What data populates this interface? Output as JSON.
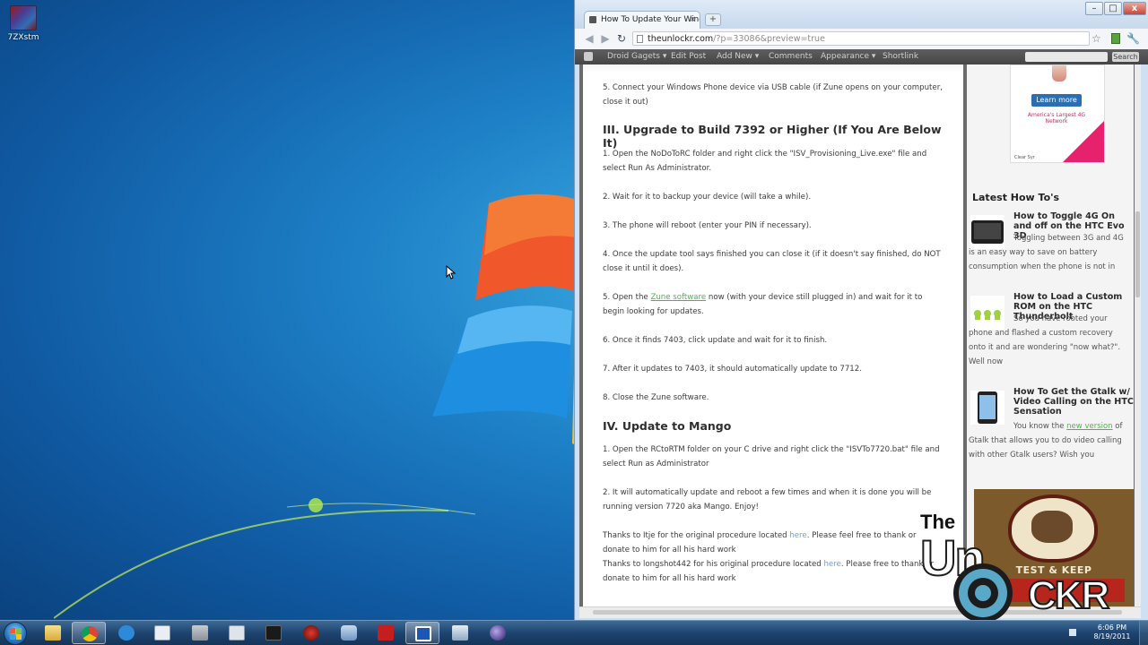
{
  "desktop": {
    "icons": [
      {
        "label": "7ZXstm"
      }
    ]
  },
  "browser": {
    "tab_title": "How To Update Your Windo",
    "tab_close": "×",
    "new_tab": "+",
    "url_host": "theunlockr.com",
    "url_path": "/?p=33086&preview=true",
    "window_buttons": {
      "minimize": "–",
      "maximize": "□",
      "close": "x"
    }
  },
  "wp_admin_bar": {
    "items": [
      "Droid Gagets ▾",
      "Edit Post",
      "Add New ▾",
      "Comments",
      "Appearance ▾",
      "Shortlink"
    ],
    "search_button": "Search"
  },
  "article": {
    "p_top": "5. Connect your Windows Phone device via USB cable (if Zune opens on your computer, close it out)",
    "h3": "III. Upgrade to Build 7392 or Higher (If You Are Below It)",
    "s3_p1": "1. Open the NoDoToRC folder and right click the \"ISV_Provisioning_Live.exe\" file and select Run As Administrator.",
    "s3_p2": "2. Wait for it to backup your device (will take a while).",
    "s3_p3": "3. The phone will reboot (enter your PIN if necessary).",
    "s3_p4": "4. Once the update tool says finished you can close it (if it doesn't say finished, do NOT close it until it does).",
    "s3_p5_a": "5. Open the ",
    "s3_p5_link": "Zune software",
    "s3_p5_b": " now (with your device still plugged in) and wait for it to begin looking for updates.",
    "s3_p6": "6. Once it finds 7403, click update and wait for it to finish.",
    "s3_p7": "7. After it updates to 7403, it should automatically update to 7712.",
    "s3_p8": "8. Close the Zune software.",
    "h4": "IV. Update to Mango",
    "s4_p1": "1. Open the RCtoRTM folder on your C drive and right click the \"ISVTo7720.bat\" file and select Run as Administrator",
    "s4_p2": "2. It will automatically update and reboot a few times and when it is done you will be running version 7720 aka Mango. Enjoy!",
    "thanks1_a": "Thanks to Itje for the original procedure located ",
    "thanks1_link": "here",
    "thanks1_b": ". Please feel free to thank or donate to him for all his hard work",
    "thanks2_a": "Thanks to longshot442 for his original procedure located ",
    "thanks2_link": "here",
    "thanks2_b": ". Please free to thank or donate to him for all his hard work"
  },
  "sidebar": {
    "ad_button": "Learn more",
    "ad_text": "America's Largest 4G Network",
    "ad_small": "Clear Syr",
    "latest_title": "Latest How To's",
    "howtos": [
      {
        "title": "How to Toggle 4G On and off on the HTC Evo 3D",
        "desc": "Toggling between 3G and 4G is an easy way to save on battery consumption when the phone is not in"
      },
      {
        "title": "How to Load a Custom ROM on the HTC Thunderbolt",
        "desc": "So you have rooted your phone and flashed a custom recovery onto it and are wondering \"now what?\". Well now"
      },
      {
        "title": "How To Get the Gtalk w/ Video Calling on the HTC Sensation",
        "desc_a": "You know the ",
        "desc_link": "new version",
        "desc_b": " of Gtalk that allows you to do video calling with other Gtalk users? Wish you"
      }
    ],
    "ad2_text": "TEST & KEEP"
  },
  "watermark": {
    "the": "The",
    "un": "Un",
    "ckr": "CKR"
  },
  "taskbar": {
    "clock_time": "6:06 PM",
    "clock_date": "8/19/2011"
  },
  "colors": {
    "desktop_bg": "#1d7fc6",
    "link_green": "#49b843",
    "link_blue": "#6aa0d8",
    "wp_bar": "#4f4f4f"
  }
}
